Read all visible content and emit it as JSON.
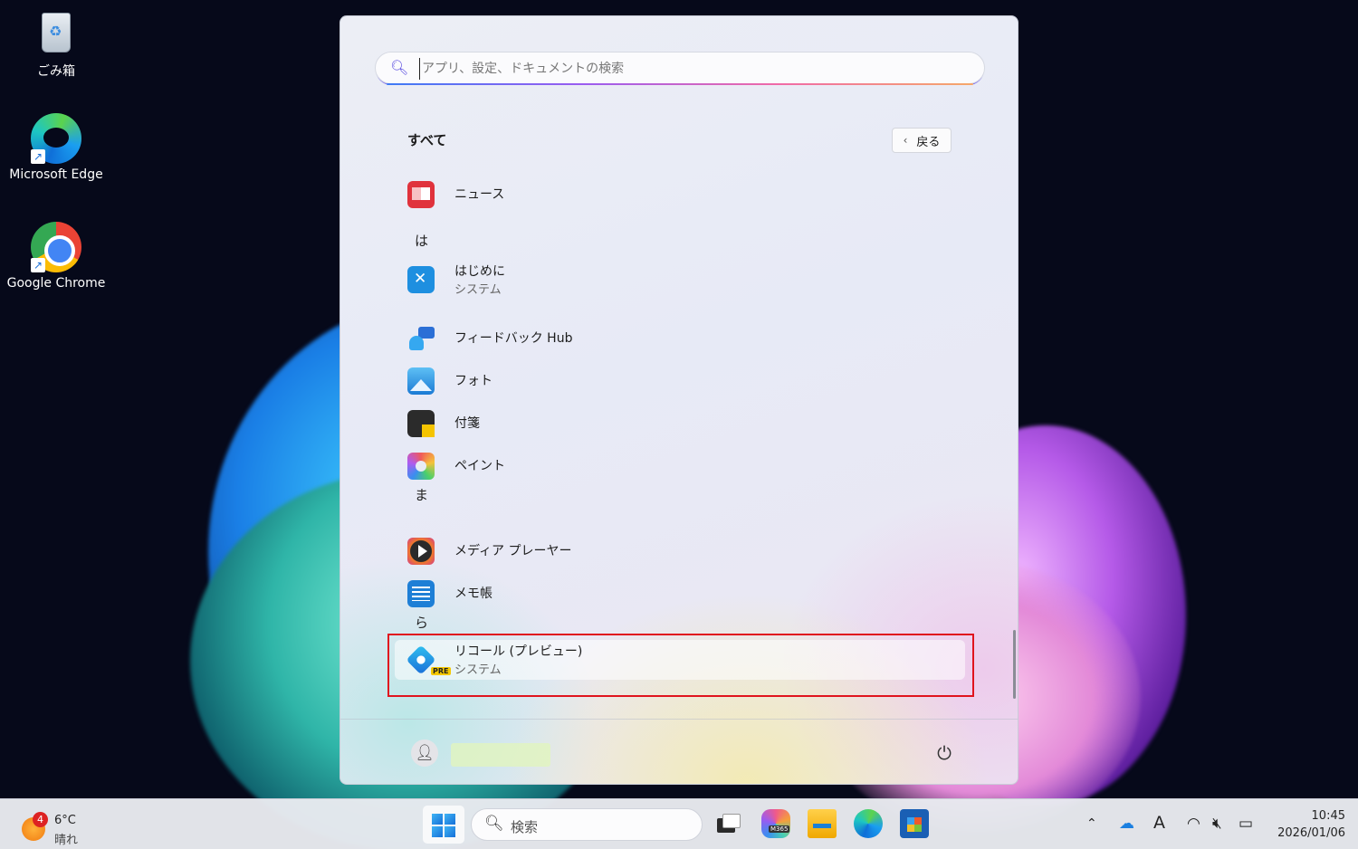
{
  "desktop": {
    "icons": [
      {
        "label": "ごみ箱",
        "icon": "recycle-bin-icon"
      },
      {
        "label": "Microsoft Edge",
        "icon": "edge-icon"
      },
      {
        "label": "Google Chrome",
        "icon": "chrome-icon"
      }
    ]
  },
  "start_menu": {
    "search_placeholder": "アプリ、設定、ドキュメントの検索",
    "section_title": "すべて",
    "back_label": "戻る",
    "items": [
      {
        "type": "app",
        "name": "ニュース",
        "icon": "news-icon"
      },
      {
        "type": "letter",
        "name": "は"
      },
      {
        "type": "app",
        "name": "はじめに",
        "subtitle": "システム",
        "icon": "get-started-icon"
      },
      {
        "type": "app",
        "name": "フィードバック Hub",
        "icon": "feedback-hub-icon"
      },
      {
        "type": "app",
        "name": "フォト",
        "icon": "photos-icon"
      },
      {
        "type": "app",
        "name": "付箋",
        "icon": "sticky-notes-icon"
      },
      {
        "type": "app",
        "name": "ペイント",
        "icon": "paint-icon"
      },
      {
        "type": "letter",
        "name": "ま"
      },
      {
        "type": "app",
        "name": "メディア プレーヤー",
        "icon": "media-player-icon"
      },
      {
        "type": "app",
        "name": "メモ帳",
        "icon": "notepad-icon"
      },
      {
        "type": "letter",
        "name": "ら"
      },
      {
        "type": "app",
        "name": "リコール (プレビュー)",
        "subtitle": "システム",
        "icon": "recall-icon",
        "badge": "PRE",
        "highlighted": true
      }
    ],
    "highlight_color": "#e0141e"
  },
  "taskbar": {
    "weather": {
      "badge": "4",
      "temp": "6°C",
      "condition": "晴れ"
    },
    "search_label": "検索",
    "m365_tag": "M365",
    "tray": {
      "ime": "A"
    },
    "clock": {
      "time": "10:45",
      "date": "2026/01/06"
    }
  }
}
